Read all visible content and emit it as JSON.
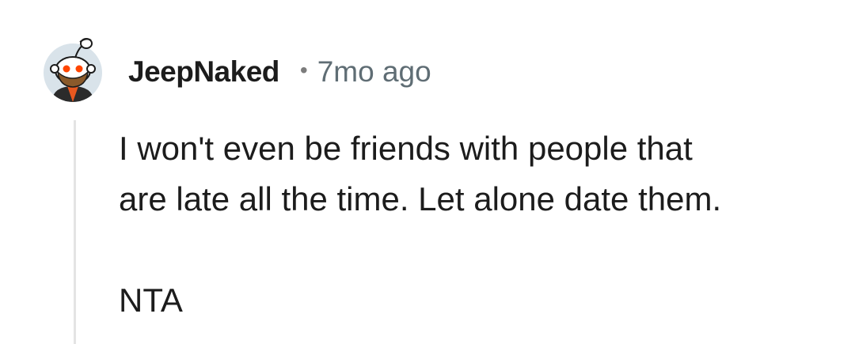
{
  "comment": {
    "username": "JeepNaked",
    "separator": "•",
    "timestamp": "7mo ago",
    "avatar_icon": "snoo-avatar-icon",
    "body": {
      "line1": "I won't even be friends with people that",
      "line2": "are late all the time. Let alone date them.",
      "verdict": "NTA"
    }
  },
  "colors": {
    "username": "#1c1c1c",
    "timestamp": "#5f6d74",
    "body_text": "#1c1c1c",
    "thread_line": "#e4e4e4",
    "avatar_bg": "#d9e3ea"
  }
}
